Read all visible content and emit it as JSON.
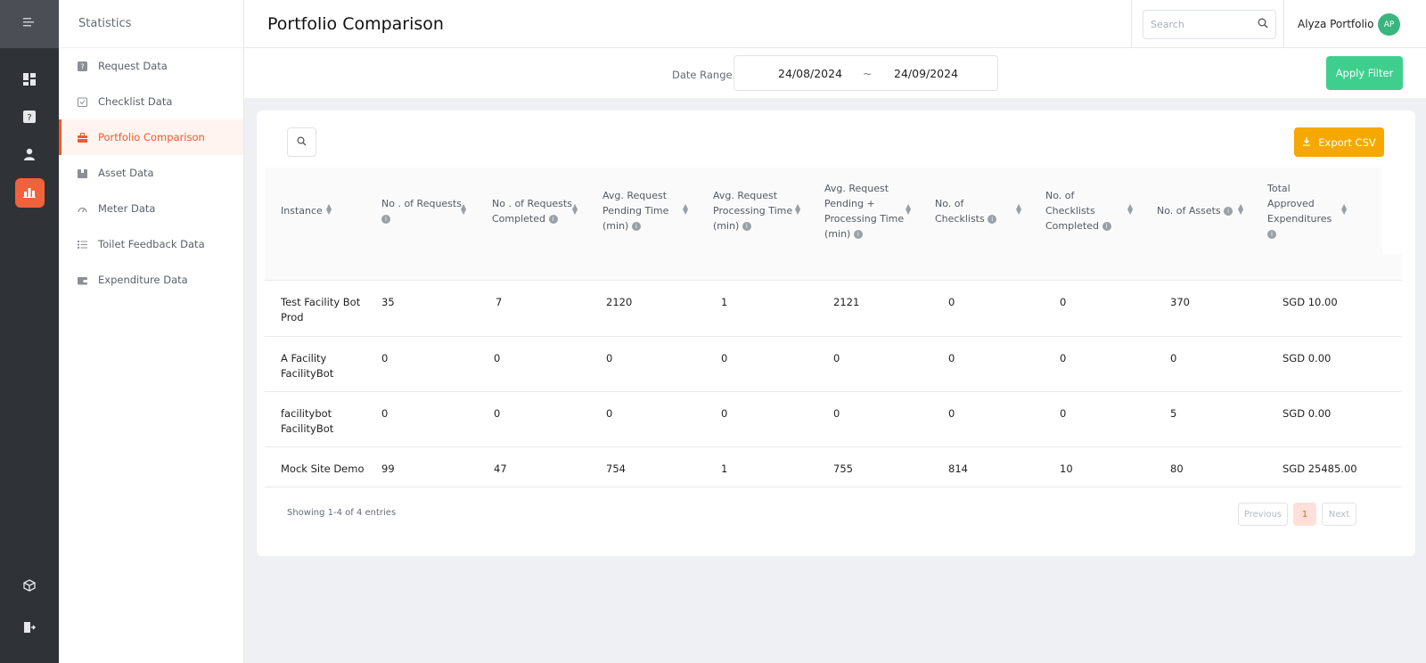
{
  "rail": {
    "menu_icon": "sidebar-toggle-icon",
    "items": [
      {
        "icon": "dashboard-icon",
        "glyph": "▦"
      },
      {
        "icon": "request-icon",
        "glyph": "?"
      },
      {
        "icon": "user-icon",
        "glyph": "●"
      },
      {
        "icon": "statistics-icon",
        "glyph": "⇪"
      }
    ],
    "bottom": [
      {
        "icon": "cube-icon",
        "glyph": "⬡"
      },
      {
        "icon": "logout-icon",
        "glyph": "⇥"
      }
    ]
  },
  "sidebar": {
    "title": "Statistics",
    "items": [
      {
        "label": "Request Data",
        "icon": "request-data-icon"
      },
      {
        "label": "Checklist Data",
        "icon": "checklist-data-icon"
      },
      {
        "label": "Portfolio Comparison",
        "icon": "portfolio-icon"
      },
      {
        "label": "Asset Data",
        "icon": "asset-data-icon"
      },
      {
        "label": "Meter Data",
        "icon": "meter-data-icon"
      },
      {
        "label": "Toilet Feedback Data",
        "icon": "toilet-feedback-icon"
      },
      {
        "label": "Expenditure Data",
        "icon": "expenditure-data-icon"
      }
    ]
  },
  "header": {
    "title": "Portfolio Comparison",
    "search_placeholder": "Search",
    "user_name": "Alyza Portfolio",
    "avatar_initials": "AP"
  },
  "filter": {
    "date_label": "Date Range",
    "start_date": "24/08/2024",
    "separator": "~",
    "end_date": "24/09/2024",
    "apply_label": "Apply Filter"
  },
  "table": {
    "export_label": "Export CSV",
    "columns": [
      "Instance",
      "No . of Requests",
      "No . of Requests Completed",
      "Avg. Request Pending Time (min)",
      "Avg. Request Processing Time (min)",
      "Avg. Request Pending + Processing Time (min)",
      "No. of Checklists",
      "No. of Checklists Completed",
      "No. of Assets",
      "Total Approved Expenditures"
    ],
    "rows": [
      [
        "Test Facility Bot Prod",
        "35",
        "7",
        "2120",
        "1",
        "2121",
        "0",
        "0",
        "370",
        "SGD 10.00"
      ],
      [
        "A Facility FacilityBot",
        "0",
        "0",
        "0",
        "0",
        "0",
        "0",
        "0",
        "0",
        "SGD 0.00"
      ],
      [
        "facilitybot FacilityBot",
        "0",
        "0",
        "0",
        "0",
        "0",
        "0",
        "0",
        "5",
        "SGD 0.00"
      ],
      [
        "Mock Site Demo",
        "99",
        "47",
        "754",
        "1",
        "755",
        "814",
        "10",
        "80",
        "SGD 25485.00"
      ]
    ],
    "showing": "Showing 1-4 of 4 entries",
    "previous": "Previous",
    "page": "1",
    "next": "Next"
  }
}
